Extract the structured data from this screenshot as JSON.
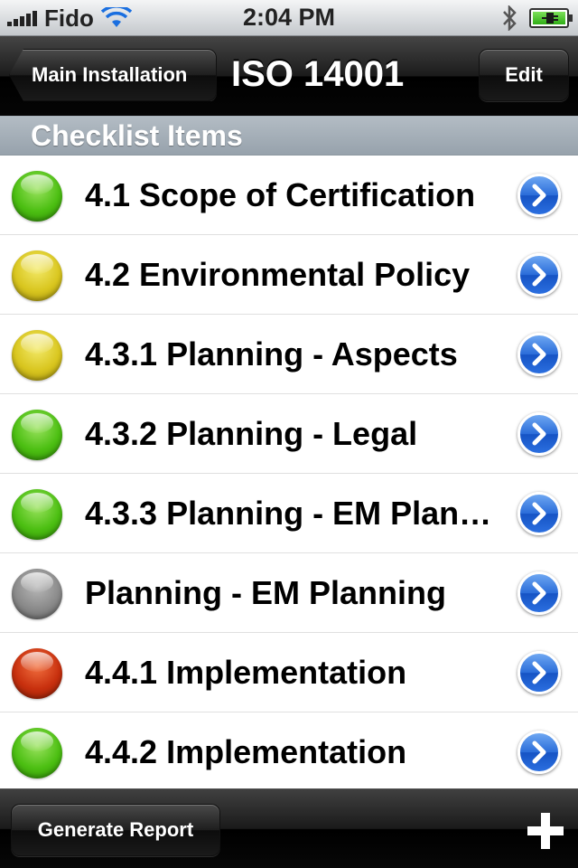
{
  "status_bar": {
    "carrier": "Fido",
    "time": "2:04 PM",
    "icons": [
      "signal-icon",
      "wifi-icon",
      "bluetooth-icon",
      "battery-charging-icon"
    ]
  },
  "nav": {
    "back_label": "Main Installation",
    "title": "ISO 14001",
    "edit_label": "Edit"
  },
  "section": {
    "header": "Checklist Items"
  },
  "colors": {
    "green": "#4cbf12",
    "yellow": "#d9c61f",
    "gray": "#8a8a8a",
    "red": "#c8300e",
    "accent_blue": "#2a6cd9"
  },
  "items": [
    {
      "label": "4.1 Scope of Certification",
      "status": "green"
    },
    {
      "label": "4.2 Environmental Policy",
      "status": "yellow"
    },
    {
      "label": "4.3.1 Planning - Aspects",
      "status": "yellow"
    },
    {
      "label": "4.3.2 Planning - Legal",
      "status": "green"
    },
    {
      "label": "4.3.3 Planning - EM Planning",
      "status": "green"
    },
    {
      "label": "Planning - EM Planning",
      "status": "gray"
    },
    {
      "label": "4.4.1 Implementation",
      "status": "red"
    },
    {
      "label": "4.4.2 Implementation",
      "status": "green"
    }
  ],
  "toolbar": {
    "report_label": "Generate Report",
    "add_icon": "plus-icon"
  }
}
